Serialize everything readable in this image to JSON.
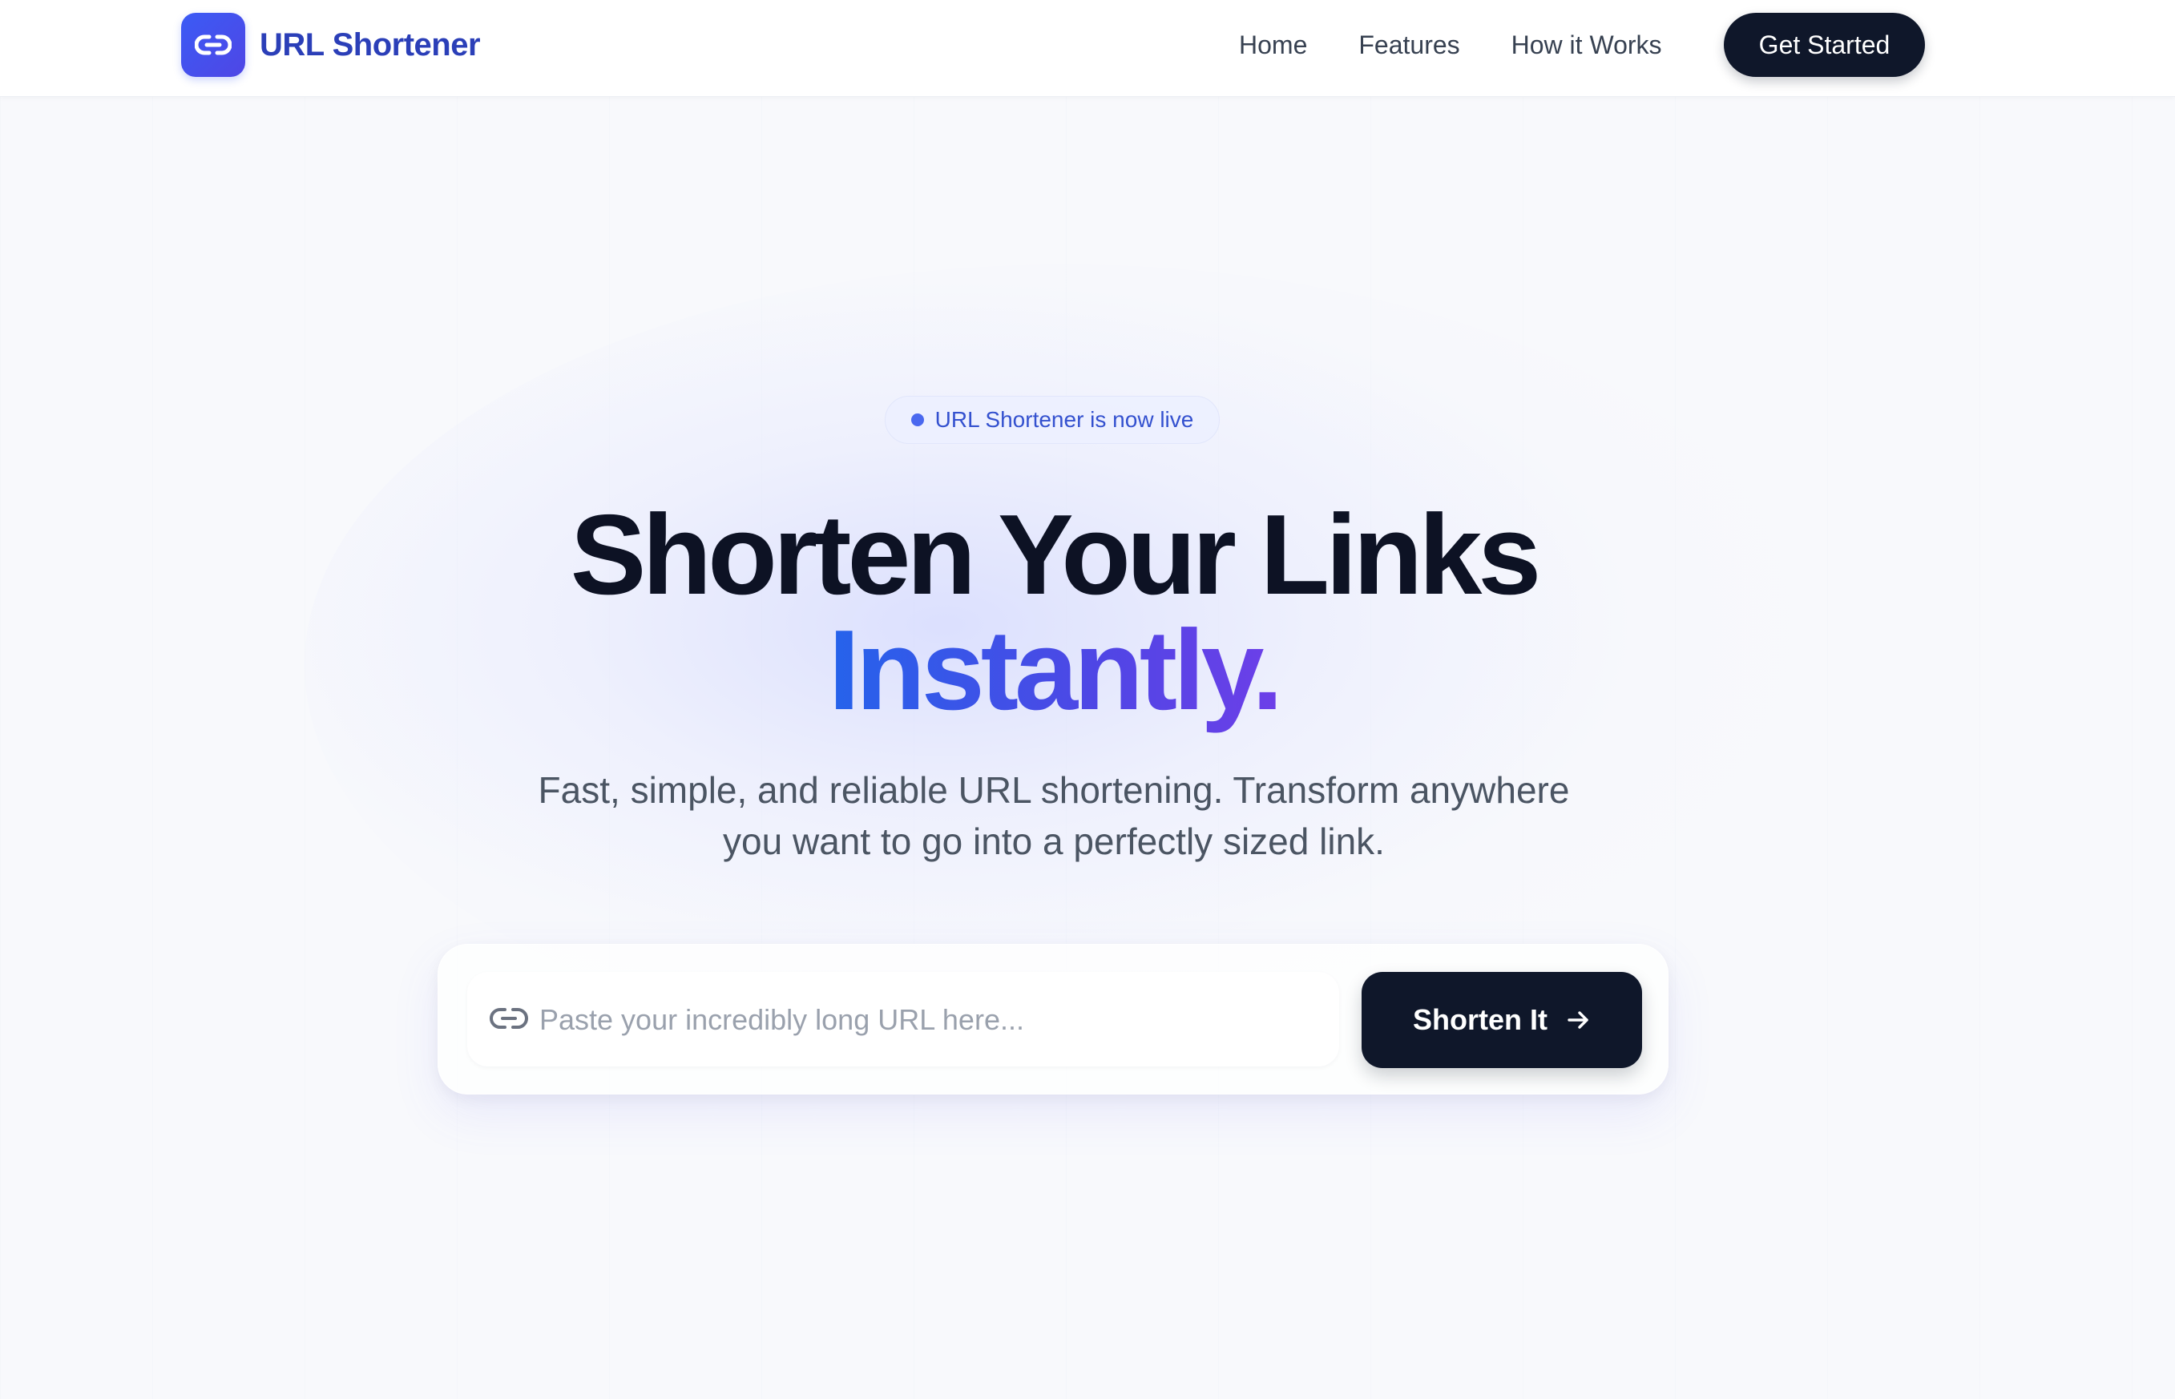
{
  "header": {
    "brand_name": "URL Shortener",
    "logo_icon": "link-icon",
    "nav": [
      {
        "label": "Home"
      },
      {
        "label": "Features"
      },
      {
        "label": "How it Works"
      }
    ],
    "cta_label": "Get Started"
  },
  "hero": {
    "badge_text": "URL Shortener is now live",
    "headline_line1": "Shorten Your Links",
    "headline_line2": "Instantly.",
    "subtitle_line1": "Fast, simple, and reliable URL shortening. Transform anywhere",
    "subtitle_line2": "you want to go into a perfectly sized link."
  },
  "form": {
    "input_placeholder": "Paste your incredibly long URL here...",
    "input_value": "",
    "input_icon": "link-icon",
    "submit_label": "Shorten It",
    "submit_icon": "arrow-right-icon"
  },
  "colors": {
    "brand": "#2b3fb8",
    "accent_gradient_start": "#2563eb",
    "accent_gradient_end": "#6d3fe8",
    "dark": "#0f172a",
    "badge_text": "#3451cf"
  }
}
